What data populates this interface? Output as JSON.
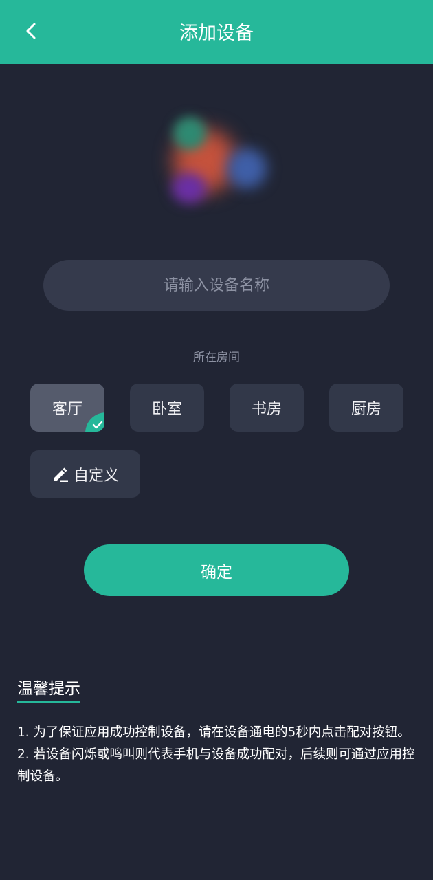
{
  "header": {
    "title": "添加设备",
    "back_icon": "chevron-left-icon"
  },
  "device": {
    "image": "device-image-blurred"
  },
  "name_input": {
    "placeholder": "请输入设备名称",
    "value": ""
  },
  "room": {
    "label": "所在房间",
    "options": [
      {
        "label": "客厅",
        "selected": true
      },
      {
        "label": "卧室",
        "selected": false
      },
      {
        "label": "书房",
        "selected": false
      },
      {
        "label": "厨房",
        "selected": false
      }
    ],
    "custom": {
      "label": "自定义",
      "icon": "pencil-icon"
    }
  },
  "confirm": {
    "label": "确定"
  },
  "tips": {
    "title": "温馨提示",
    "lines": [
      "1. 为了保证应用成功控制设备，请在设备通电的5秒内点击配对按钮。",
      "2. 若设备闪烁或鸣叫则代表手机与设备成功配对，后续则可通过应用控制设备。"
    ]
  },
  "colors": {
    "accent": "#26b89a",
    "background": "#212534",
    "card": "#323849",
    "selected_card": "#555b6c"
  }
}
